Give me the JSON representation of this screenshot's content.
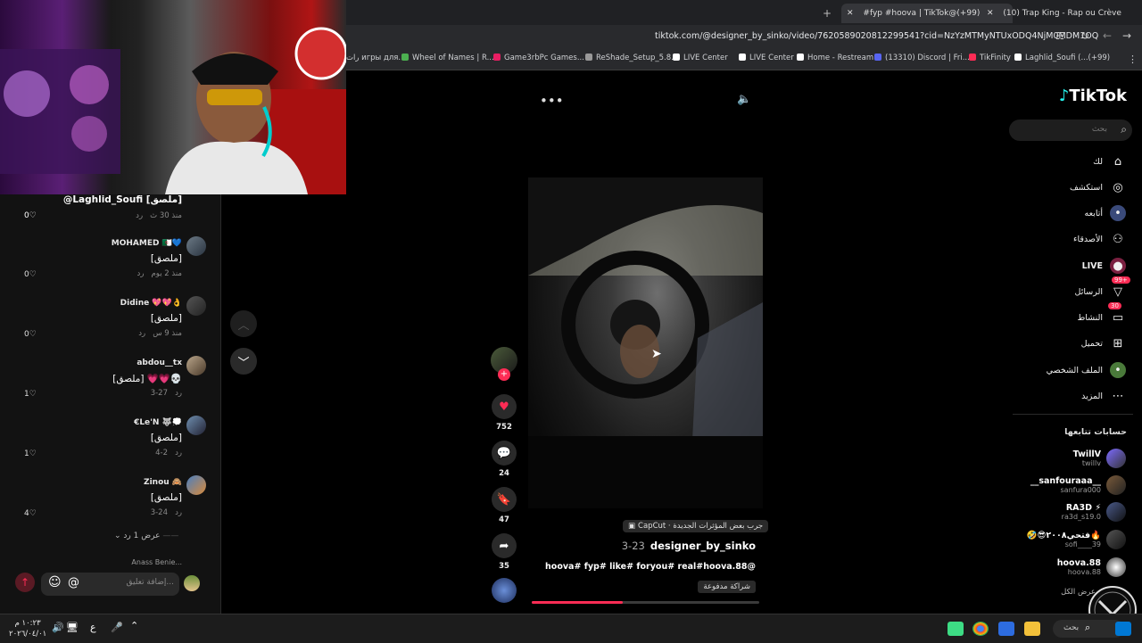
{
  "browser": {
    "tabs": [
      {
        "label": "#fyp #hoova | TikTok@(+99)",
        "active": true
      },
      {
        "label": "(10) Trap King - Rap ou Crève",
        "active": false
      }
    ],
    "new_tab_icon": "plus-icon",
    "url": "tiktok.com/@designer_by_sinko/video/7620589020812299541?cid=NzYzMTMyNTUxODQ4NjM0MDM1OQ",
    "bookmarks": [
      "رات игры для...",
      "Wheel of Names | R...",
      "Game3rbPc Games...",
      "ReShade_Setup_5.8.0",
      "LIVE Center",
      "LIVE Center",
      "Home - Restream",
      "(13310) Discord | Fri...",
      "TikFinity",
      "Laghlid_Soufi (...(+99)"
    ]
  },
  "comments": {
    "reply_header": "@Laghlid_Soufi [ملصق]",
    "first_meta": "منذ 30 ث",
    "first_reply": "رد",
    "first_likes": "0",
    "items": [
      {
        "name": "MOHAMED 🇩🇿💙",
        "text": "[ملصق]",
        "time": "منذ 2 يوم",
        "reply": "رد",
        "likes": "0"
      },
      {
        "name": "Didine 💖💖👌",
        "text": "[ملصق]",
        "time": "منذ 9 س",
        "reply": "رد",
        "likes": "0"
      },
      {
        "name": "abdou__tx",
        "text": "[ملصق] 💗💗💀",
        "time": "3-27",
        "reply": "رد",
        "likes": "1"
      },
      {
        "name": "€Le'N 🐺💭",
        "text": "[ملصق]",
        "time": "4-2",
        "reply": "رد",
        "likes": "1"
      },
      {
        "name": "Zinou 🙈",
        "text": "[ملصق]",
        "time": "3-24",
        "reply": "رد",
        "likes": "4"
      }
    ],
    "show_replies": "عرض 1 رد",
    "cut_name": "Anass Benie...",
    "input_placeholder": "إضافة تعليق...",
    "at_label": "@"
  },
  "video": {
    "menu_icon": "more-icon",
    "sound_icon": "volume-icon",
    "effect_label": "CapCut · جرب بعض المؤثرات الجديدة",
    "author": "designer_by_sinko",
    "date": "3-23",
    "caption": "hoova# fyp# like# foryou# real#hoova.88@",
    "paid_badge": "شراكة مدفوعة",
    "progress": 0.4,
    "likes": "752",
    "comments": "24",
    "saves": "47",
    "shares": "35"
  },
  "sidebar": {
    "logo": "TikTok",
    "search_placeholder": "بحث",
    "items": [
      {
        "label": "لك",
        "icon": "home-icon"
      },
      {
        "label": "استكشف",
        "icon": "compass-icon"
      },
      {
        "label": "أتابعه",
        "icon": "following-icon"
      },
      {
        "label": "الأصدقاء",
        "icon": "friends-icon"
      },
      {
        "label": "LIVE",
        "icon": "live-icon"
      },
      {
        "label": "الرسائل",
        "icon": "messages-icon",
        "badge": "99+"
      },
      {
        "label": "النشاط",
        "icon": "activity-icon",
        "badge": "30"
      },
      {
        "label": "تحميل",
        "icon": "upload-icon"
      },
      {
        "label": "الملف الشخصي",
        "icon": "profile-icon"
      },
      {
        "label": "المزيد",
        "icon": "more-dots-icon"
      }
    ],
    "following_title": "حسابات تتابعها",
    "following": [
      {
        "name": "TwillV",
        "handle": "twillv"
      },
      {
        "name": "__sanfouraaa__",
        "handle": "sanfura000"
      },
      {
        "name": "RA3D ⚡",
        "handle": "ra3d_s19.0"
      },
      {
        "name": "🤣😎فتحي٢٠٠٨🔥",
        "handle": "sofi____39"
      },
      {
        "name": "hoova.88",
        "handle": "hoova.88"
      }
    ],
    "see_all": "عرض الكل"
  },
  "taskbar": {
    "clock_time": "١٠:٢٣ م",
    "clock_date": "٢٠٢٦/٠٤/٠١",
    "lang": "ع",
    "search_label": "بحث"
  },
  "colors": {
    "accent": "#fe2c55",
    "background": "#000000",
    "panel": "#121212"
  }
}
